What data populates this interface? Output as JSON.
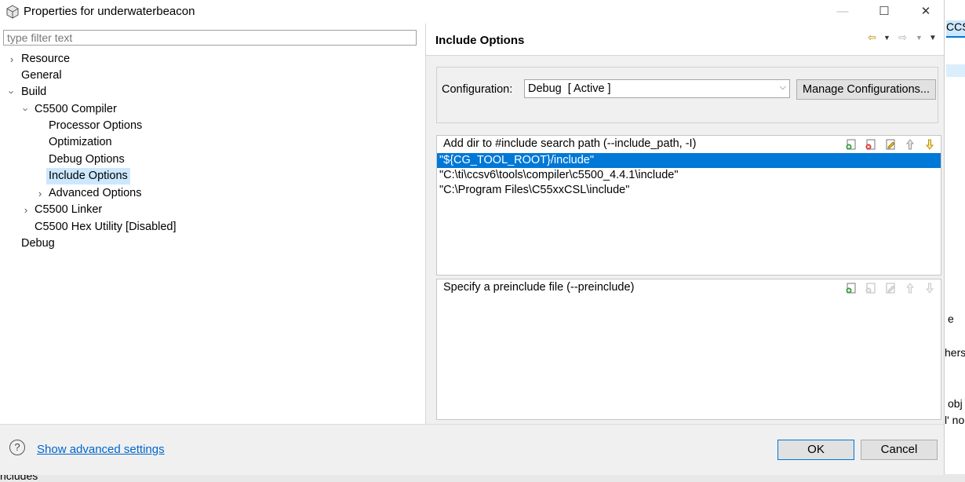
{
  "window": {
    "title": "Properties for underwaterbeacon",
    "minimize": "—",
    "maximize": "☐",
    "close": "✕"
  },
  "filter": {
    "placeholder": "type filter text"
  },
  "tree": {
    "resource": "Resource",
    "general": "General",
    "build": "Build",
    "compiler": "C5500 Compiler",
    "processor_options": "Processor Options",
    "optimization": "Optimization",
    "debug_options": "Debug Options",
    "include_options": "Include Options",
    "advanced_options": "Advanced Options",
    "linker": "C5500 Linker",
    "hex_utility": "C5500 Hex Utility  [Disabled]",
    "debug": "Debug"
  },
  "page": {
    "title": "Include Options",
    "configuration_label": "Configuration:",
    "configuration_value": "Debug  [ Active ]",
    "manage_button": "Manage Configurations...",
    "include_path": {
      "title": "Add dir to #include search path (--include_path, -I)",
      "items": [
        "\"${CG_TOOL_ROOT}/include\"",
        "\"C:\\ti\\ccsv6\\tools\\compiler\\c5500_4.4.1\\include\"",
        "\"C:\\Program Files\\C55xxCSL\\include\""
      ]
    },
    "preinclude": {
      "title": "Specify a preinclude file (--preinclude)"
    }
  },
  "footer": {
    "advanced_link": "Show advanced settings",
    "ok": "OK",
    "cancel": "Cancel"
  },
  "background": {
    "tab_text": "CCS",
    "frag1": "e",
    "frag2": "hers",
    "frag3": "obj",
    "frag4": "l' no",
    "bottom_text": "ncludes"
  },
  "colors": {
    "selection": "#0078d7",
    "tree_selection": "#cce8ff",
    "link": "#0066cc"
  }
}
